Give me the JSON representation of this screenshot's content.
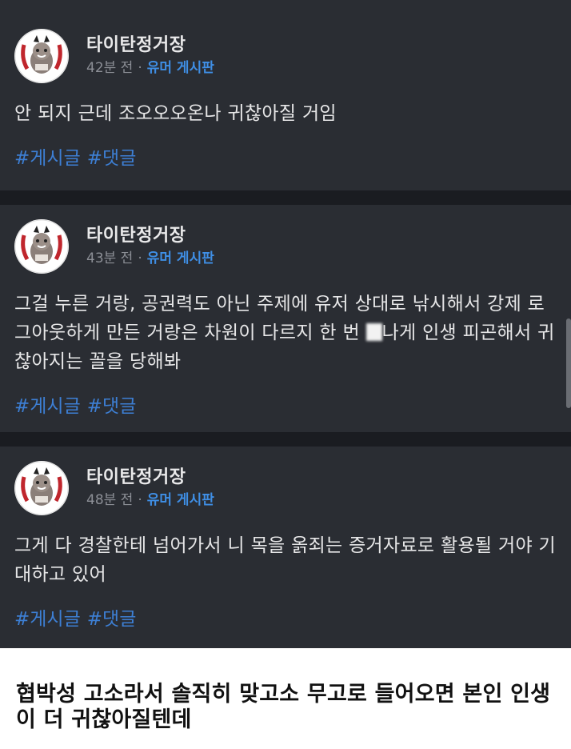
{
  "posts": [
    {
      "author": "타이탄정거장",
      "time": "42분 전",
      "board": "유머 게시판",
      "text": "안 되지 근데 조오오오온나 귀찮아질 거임",
      "tags": [
        "#게시글",
        "#댓글"
      ]
    },
    {
      "author": "타이탄정거장",
      "time": "43분 전",
      "board": "유머 게시판",
      "text_a": "그걸 누른 거랑, 공권력도 아닌 주제에 유저 상대로 낚시해서 강제 로그아웃하게 만든 거랑은 차원이 다르지 한 번 ",
      "text_b": "나게 인생 피곤해서 귀찮아지는 꼴을 당해봐",
      "tags": [
        "#게시글",
        "#댓글"
      ]
    },
    {
      "author": "타이탄정거장",
      "time": "48분 전",
      "board": "유머 게시판",
      "text": "그게 다 경찰한테 넘어가서 니 목을 옭죄는 증거자료로 활용될 거야 기대하고 있어",
      "tags": [
        "#게시글",
        "#댓글"
      ]
    }
  ],
  "caption": "협박성 고소라서 솔직히 맞고소 무고로 들어오면 본인 인생이 더 귀찮아질텐데",
  "icons": {
    "avatar": "raccoon-avatar-icon"
  },
  "colors": {
    "card": "#2a2d33",
    "separator": "#1a1c21",
    "board": "#3f8fe6",
    "tag": "#3d7fd4"
  }
}
